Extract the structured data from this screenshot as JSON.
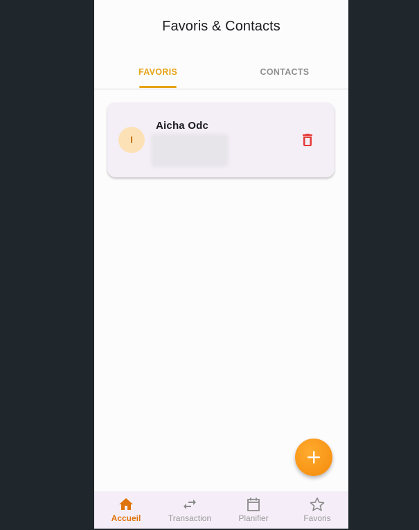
{
  "header": {
    "title": "Favoris & Contacts"
  },
  "tabs": [
    {
      "label": "FAVORIS",
      "active": true
    },
    {
      "label": "CONTACTS",
      "active": false
    }
  ],
  "favorites": [
    {
      "initial": "I",
      "name": "Aicha Odc"
    }
  ],
  "icons": {
    "delete": "trash-icon",
    "fab": "plus-icon"
  },
  "bottom_nav": [
    {
      "label": "Accueil",
      "icon": "home-icon",
      "active": true
    },
    {
      "label": "Transaction",
      "icon": "swap-arrows-icon",
      "active": false
    },
    {
      "label": "Planifier",
      "icon": "calendar-icon",
      "active": false
    },
    {
      "label": "Favoris",
      "icon": "star-icon",
      "active": false
    }
  ],
  "colors": {
    "accent": "#e6a317",
    "nav_active": "#e0740c",
    "delete": "#e53935",
    "fab": "#f7921a"
  }
}
